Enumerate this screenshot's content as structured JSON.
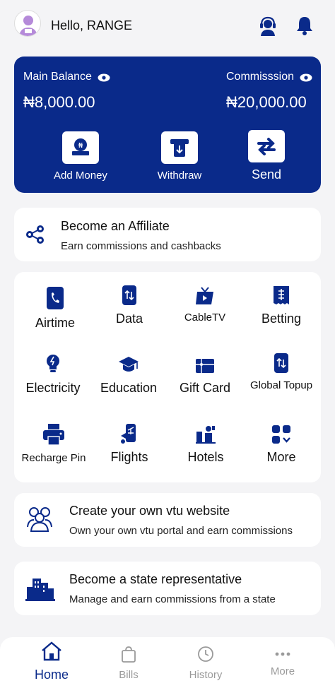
{
  "header": {
    "greeting": "Hello, RANGE",
    "icons": [
      "avatar",
      "support-agent-icon",
      "bell-icon"
    ]
  },
  "balance": {
    "main_label": "Main Balance",
    "main_value": "₦8,000.00",
    "commission_label": "Commisssion",
    "commission_value": "₦20,000.00",
    "actions": [
      {
        "label": "Add Money",
        "icon": "add-money-icon"
      },
      {
        "label": "Withdraw",
        "icon": "withdraw-icon"
      },
      {
        "label": "Send",
        "icon": "send-icon"
      }
    ]
  },
  "affiliate": {
    "title": "Become an Affiliate",
    "subtitle": "Earn commissions and cashbacks"
  },
  "services": [
    {
      "label": "Airtime",
      "icon": "phone-icon"
    },
    {
      "label": "Data",
      "icon": "data-icon"
    },
    {
      "label": "CableTV",
      "icon": "tv-icon"
    },
    {
      "label": "Betting",
      "icon": "betting-icon"
    },
    {
      "label": "Electricity",
      "icon": "bulb-icon"
    },
    {
      "label": "Education",
      "icon": "graduation-cap-icon"
    },
    {
      "label": "Gift Card",
      "icon": "gift-card-icon"
    },
    {
      "label": "Global Topup",
      "icon": "global-topup-icon"
    },
    {
      "label": "Recharge Pin",
      "icon": "printer-icon"
    },
    {
      "label": "Flights",
      "icon": "flights-icon"
    },
    {
      "label": "Hotels",
      "icon": "hotel-icon"
    },
    {
      "label": "More",
      "icon": "grid-more-icon"
    }
  ],
  "vtu_website": {
    "title": "Create your own vtu website",
    "subtitle": "Own your own vtu portal and earn commissions"
  },
  "state_rep": {
    "title": "Become a state representative",
    "subtitle": "Manage and earn commissions from a state"
  },
  "bottom_nav": [
    {
      "label": "Home",
      "icon": "home-icon",
      "active": true
    },
    {
      "label": "Bills",
      "icon": "bag-icon",
      "active": false
    },
    {
      "label": "History",
      "icon": "clock-icon",
      "active": false
    },
    {
      "label": "More",
      "icon": "dots-icon",
      "active": false
    }
  ],
  "colors": {
    "primary": "#0a2a8a",
    "background": "#f4f4f6",
    "inactive": "#9a9a9a"
  }
}
